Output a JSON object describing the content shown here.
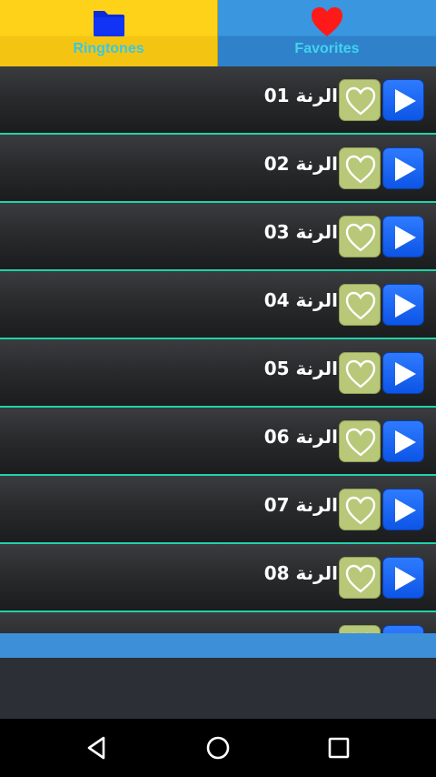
{
  "tabs": {
    "ringtones": {
      "label": "Ringtones",
      "icon": "folder-icon",
      "color": "#ffd21a"
    },
    "favorites": {
      "label": "Favorites",
      "icon": "heart-icon",
      "color": "#3a96df"
    }
  },
  "list": {
    "items": [
      {
        "title": "الرنة 01"
      },
      {
        "title": "الرنة 02"
      },
      {
        "title": "الرنة 03"
      },
      {
        "title": "الرنة 04"
      },
      {
        "title": "الرنة 05"
      },
      {
        "title": "الرنة 06"
      },
      {
        "title": "الرنة 07"
      },
      {
        "title": "الرنة 08"
      },
      {
        "title": ""
      }
    ],
    "accent_divider": "#1fd3a8",
    "favorite_button_color": "#b7c878",
    "play_button_color": "#1a63f0"
  },
  "navbar": {
    "back": "back-triangle-icon",
    "home": "home-circle-icon",
    "recents": "recents-square-icon"
  }
}
